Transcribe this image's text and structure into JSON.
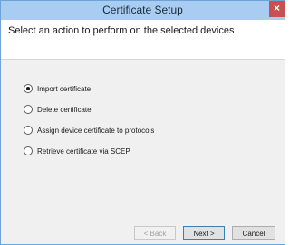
{
  "window": {
    "title": "Certificate Setup",
    "close_glyph": "×"
  },
  "header": {
    "instruction": "Select an action to perform on the selected devices"
  },
  "options": [
    {
      "label": "Import certificate",
      "selected": true
    },
    {
      "label": "Delete certificate",
      "selected": false
    },
    {
      "label": "Assign device certificate to protocols",
      "selected": false
    },
    {
      "label": "Retrieve certificate via SCEP",
      "selected": false
    }
  ],
  "buttons": {
    "back": "< Back",
    "next": "Next >",
    "cancel": "Cancel"
  }
}
